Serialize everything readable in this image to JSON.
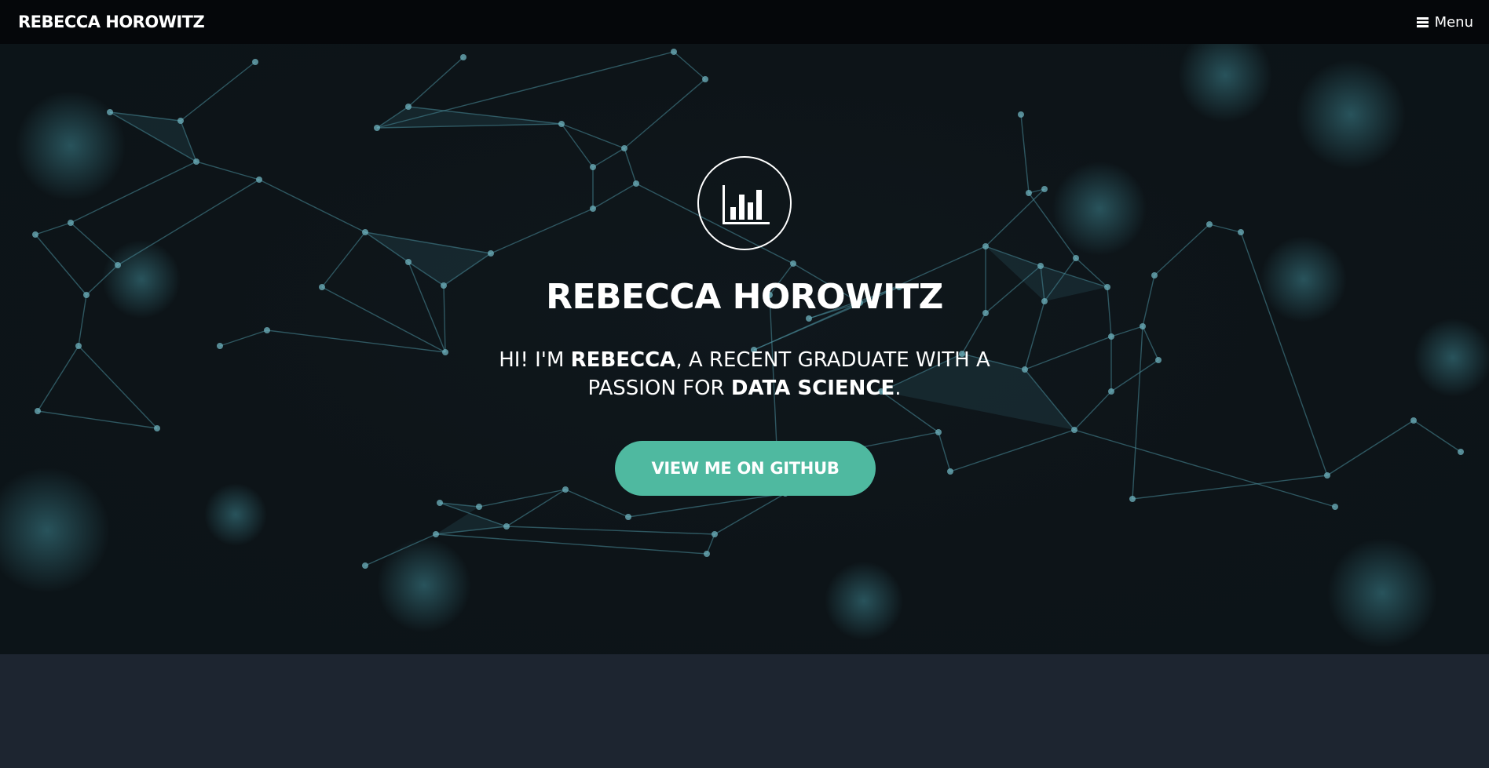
{
  "navbar": {
    "brand": "REBECCA HOROWITZ",
    "menu_label": "Menu",
    "menu_icon": "hamburger-icon"
  },
  "hero": {
    "logo_icon": "bar-chart-icon",
    "title": "REBECCA HOROWITZ",
    "subtitle": {
      "part1": "Hi! I'm ",
      "name": "Rebecca",
      "part2": ", a recent graduate with a passion for ",
      "focus": "Data Science",
      "part3": "."
    },
    "cta_label": "VIEW ME ON GITHUB",
    "background": "network-graph-image"
  },
  "colors": {
    "navbar_bg": "#05070a",
    "hero_bg": "#0d1418",
    "accent": "#4fb9a0",
    "lower_bg": "#1d2530",
    "network_line": "#4a8e9c"
  }
}
